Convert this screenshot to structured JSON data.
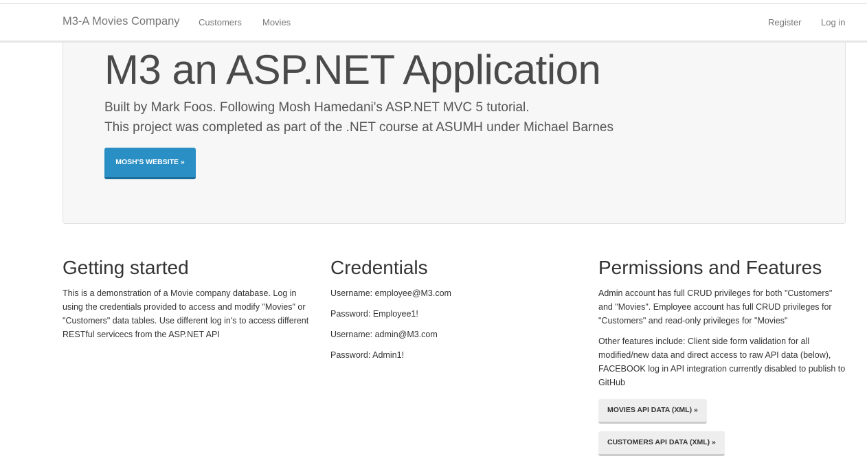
{
  "navbar": {
    "brand": "M3-A Movies Company",
    "links": [
      "Customers",
      "Movies"
    ],
    "register": "Register",
    "login": "Log in"
  },
  "jumbotron": {
    "title": "M3 an ASP.NET Application",
    "lead_line1": "Built by Mark Foos. Following Mosh Hamedani's ASP.NET MVC 5 tutorial.",
    "lead_line2": "This project was completed as part of the .NET course at ASUMH under Michael Barnes",
    "button": "Mosh's Website »"
  },
  "columns": {
    "getting_started": {
      "title": "Getting started",
      "text": "This is a demonstration of a Movie company database. Log in using the credentials provided to access and modify \"Movies\" or \"Customers\" data tables. Use different log in's to access different RESTful servicecs from the ASP.NET API"
    },
    "credentials": {
      "title": "Credentials",
      "lines": [
        "Username: employee@M3.com",
        "Password: Employee1!",
        "Username: admin@M3.com",
        "Password: Admin1!"
      ]
    },
    "permissions": {
      "title": "Permissions and Features",
      "para1": "Admin account has full CRUD privileges for both \"Customers\" and \"Movies\". Employee account has full CRUD privileges for \"Customers\" and read-only privileges for \"Movies\"",
      "para2": "Other features include: Client side form validation for all modified/new data and direct access to raw API data (below), FACEBOOK log in API integration currently disabled to publish to GitHub",
      "movies_button": "Movies API Data (XML) »",
      "customers_button": "Customers API Data (XML) »"
    }
  }
}
